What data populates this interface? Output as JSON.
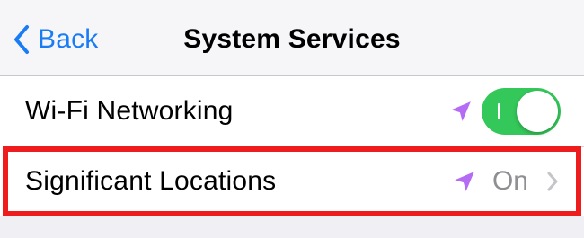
{
  "navbar": {
    "back_label": "Back",
    "title": "System Services"
  },
  "rows": [
    {
      "label": "Wi-Fi Networking",
      "icon": "location-arrow-icon",
      "control": "toggle",
      "toggle_on": true
    },
    {
      "label": "Significant Locations",
      "icon": "location-arrow-icon",
      "value": "On",
      "accessory": "chevron-right-icon"
    }
  ],
  "colors": {
    "accent": "#1a7cf5",
    "toggle_on": "#34c759",
    "location_icon": "#b56cf5",
    "highlight": "#ee1c1c",
    "value_text": "#8e8e93"
  }
}
